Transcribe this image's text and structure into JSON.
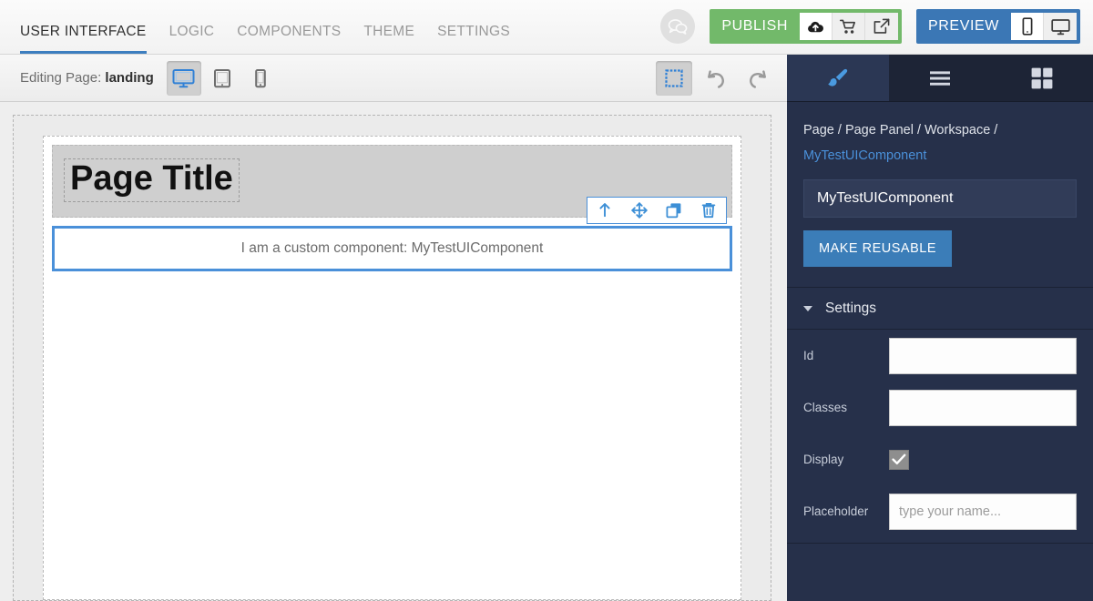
{
  "topnav": {
    "tabs": [
      {
        "label": "USER INTERFACE",
        "active": true
      },
      {
        "label": "LOGIC",
        "active": false
      },
      {
        "label": "COMPONENTS",
        "active": false
      },
      {
        "label": "THEME",
        "active": false
      },
      {
        "label": "SETTINGS",
        "active": false
      }
    ],
    "chat_icon": "speech-bubbles-icon",
    "publish": {
      "label": "PUBLISH",
      "color": "#72b96a",
      "actions": [
        "cloud-upload-icon",
        "shopping-cart-icon",
        "external-link-icon"
      ]
    },
    "preview": {
      "label": "PREVIEW",
      "color": "#3b77b5",
      "devices": [
        "mobile-icon",
        "desktop-icon"
      ],
      "selected_device": "mobile-icon"
    }
  },
  "subbar": {
    "editing_prefix": "Editing Page:",
    "page_name": "landing",
    "devices": [
      "desktop-icon",
      "tablet-icon",
      "mobile-icon"
    ],
    "selected_device": "desktop-icon",
    "outline_toggle": "outline-square-icon",
    "undo": "undo-icon",
    "redo": "redo-icon"
  },
  "canvas": {
    "page_title": "Page Title",
    "widget_text": "I am a custom component: MyTestUIComponent",
    "float_tools": [
      "arrow-up-icon",
      "move-icon",
      "duplicate-icon",
      "trash-icon"
    ],
    "selection_color": "#4a90d9"
  },
  "panel": {
    "tabs": [
      "brush-icon",
      "hamburger-menu-icon",
      "grid-icon"
    ],
    "active_tab": "brush-icon",
    "breadcrumb_path": "Page / Page Panel / Workspace /",
    "breadcrumb_current": "MyTestUIComponent",
    "component_name": "MyTestUIComponent",
    "make_reusable_label": "MAKE REUSABLE",
    "settings_section": "Settings",
    "fields": {
      "id_label": "Id",
      "id_value": "",
      "classes_label": "Classes",
      "classes_value": "",
      "display_label": "Display",
      "display_checked": "✔",
      "placeholder_label": "Placeholder",
      "placeholder_value": "",
      "placeholder_hint": "type your name..."
    }
  }
}
